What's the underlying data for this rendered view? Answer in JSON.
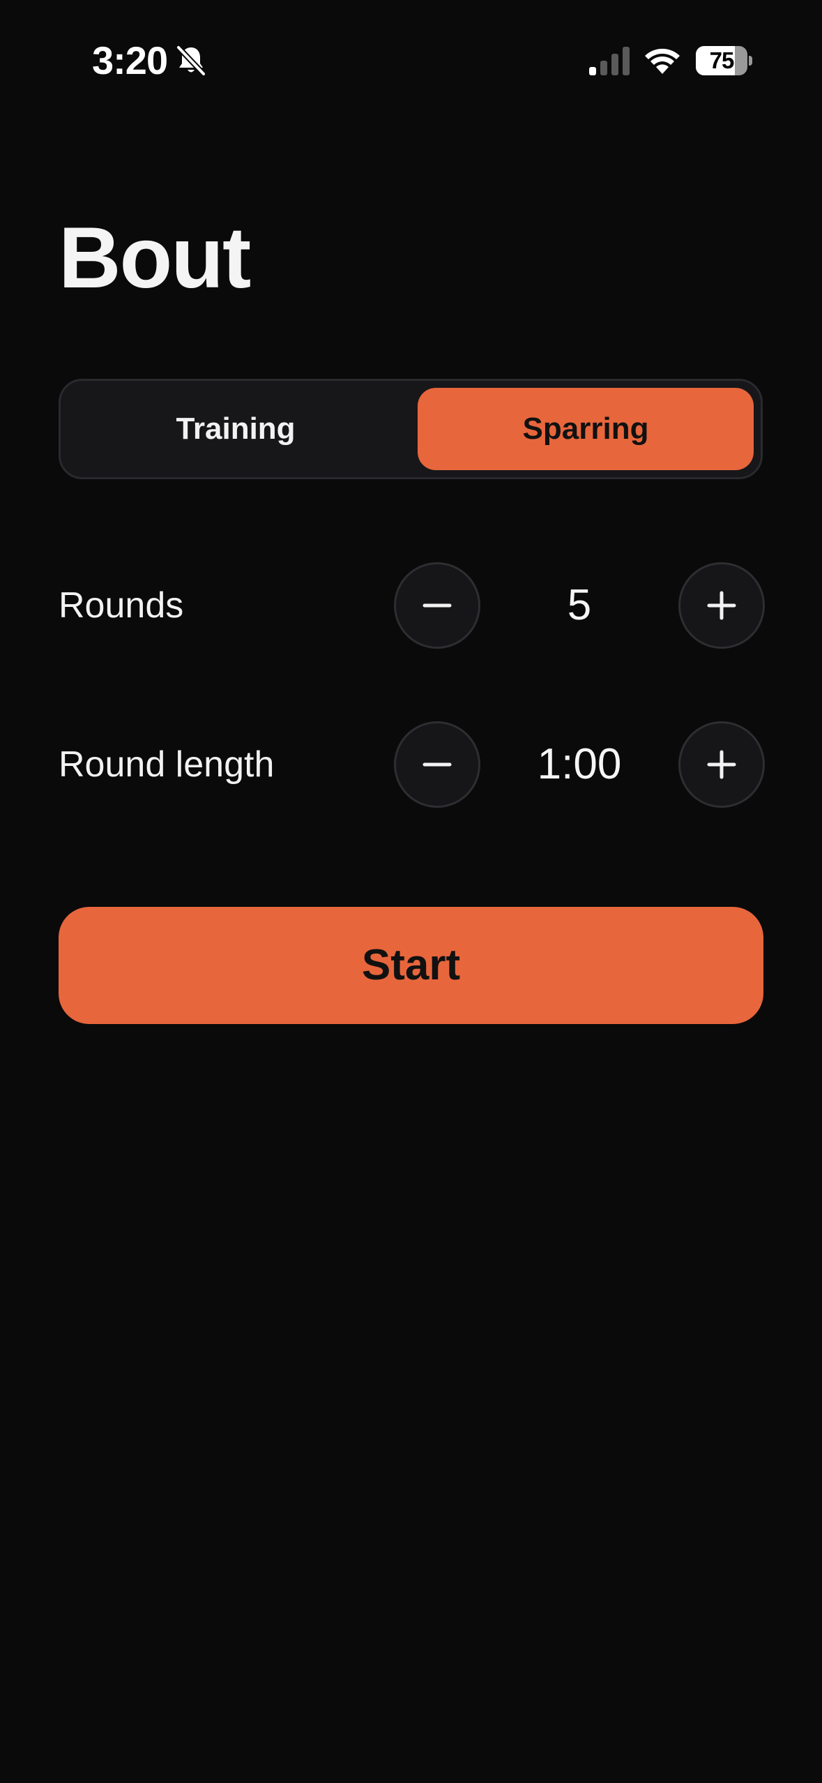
{
  "status_bar": {
    "time": "3:20",
    "battery_level": "75",
    "battery_fraction": 0.75,
    "icons": [
      "bell-slash-icon",
      "cellular-signal-icon",
      "wifi-icon",
      "battery-icon"
    ]
  },
  "app": {
    "title": "Bout"
  },
  "mode_selector": {
    "options": [
      {
        "label": "Training",
        "selected": false
      },
      {
        "label": "Sparring",
        "selected": true
      }
    ]
  },
  "settings": {
    "rounds": {
      "label": "Rounds",
      "value": "5"
    },
    "round_length": {
      "label": "Round length",
      "value": "1:00"
    },
    "decrement_icon": "minus-icon",
    "increment_icon": "plus-icon"
  },
  "actions": {
    "start_label": "Start"
  },
  "colors": {
    "background": "#0a0a0a",
    "accent": "#e8663c",
    "surface": "#17171a",
    "text": "#f2f2f2"
  }
}
